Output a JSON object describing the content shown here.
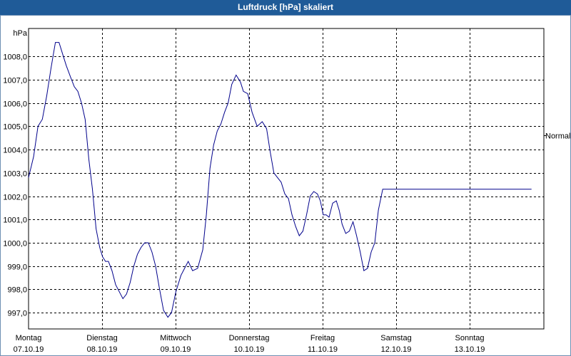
{
  "window": {
    "title": "Luftdruck [hPa] skaliert"
  },
  "chart_data": {
    "type": "line",
    "title": "Luftdruck [hPa] skaliert",
    "ylabel": "hPa",
    "ylim": [
      996.3,
      1009.2
    ],
    "yticks": [
      "997,0",
      "998,0",
      "999,0",
      "1000,0",
      "1001,0",
      "1002,0",
      "1003,0",
      "1004,0",
      "1005,0",
      "1006,0",
      "1007,0",
      "1008,0"
    ],
    "ytick_values": [
      997,
      998,
      999,
      1000,
      1001,
      1002,
      1003,
      1004,
      1005,
      1006,
      1007,
      1008
    ],
    "xlim": [
      0,
      7.1
    ],
    "days": [
      {
        "weekday": "Montag",
        "date": "07.10.19"
      },
      {
        "weekday": "Dienstag",
        "date": "08.10.19"
      },
      {
        "weekday": "Mittwoch",
        "date": "09.10.19"
      },
      {
        "weekday": "Donnerstag",
        "date": "10.10.19"
      },
      {
        "weekday": "Freitag",
        "date": "11.10.19"
      },
      {
        "weekday": "Samstag",
        "date": "12.10.19"
      },
      {
        "weekday": "Sonntag",
        "date": "13.10.19"
      }
    ],
    "reference": {
      "label": "Normal",
      "value": 1004.6
    },
    "grid": true,
    "series": [
      {
        "color": "#00008b",
        "x": [
          0,
          0.07,
          0.13,
          0.19,
          0.25,
          0.31,
          0.37,
          0.42,
          0.48,
          0.52,
          0.58,
          0.63,
          0.68,
          0.73,
          0.78,
          0.83,
          0.88,
          0.93,
          0.98,
          1.02,
          1.06,
          1.1,
          1.15,
          1.2,
          1.25,
          1.3,
          1.35,
          1.4,
          1.45,
          1.5,
          1.55,
          1.6,
          1.65,
          1.7,
          1.75,
          1.8,
          1.86,
          1.92,
          1.97,
          2.03,
          2.1,
          2.15,
          2.2,
          2.26,
          2.33,
          2.4,
          2.45,
          2.5,
          2.55,
          2.6,
          2.65,
          2.7,
          2.75,
          2.8,
          2.86,
          2.92,
          2.96,
          3.02,
          3.08,
          3.15,
          3.22,
          3.28,
          3.33,
          3.38,
          3.43,
          3.48,
          3.53,
          3.58,
          3.63,
          3.68,
          3.73,
          3.78,
          3.83,
          3.88,
          3.93,
          3.98,
          4.02,
          4.06,
          4.1,
          4.14,
          4.19,
          4.24,
          4.28,
          4.32,
          4.37,
          4.42,
          4.47,
          4.52,
          4.57,
          4.62,
          4.67,
          4.72,
          4.77,
          4.82,
          4.88,
          4.93,
          4.98,
          5.03,
          5.08,
          5.13,
          5.18,
          5.23,
          5.28,
          5.33,
          5.38,
          5.43,
          5.48,
          5.53,
          5.58,
          5.63,
          5.68,
          5.73,
          5.78,
          5.83,
          5.88,
          5.93,
          5.98,
          6.03,
          6.08,
          6.13,
          6.18,
          6.23,
          6.28,
          6.33,
          6.38,
          6.43,
          6.48,
          6.53,
          6.58,
          6.63,
          6.68,
          6.73,
          6.78,
          6.83,
          6.88,
          6.93,
          6.98
        ],
        "values": [
          1002.8,
          1003.7,
          1005.0,
          1005.3,
          1006.3,
          1007.5,
          1008.6,
          1008.6,
          1008.0,
          1007.6,
          1007.1,
          1006.7,
          1006.5,
          1006.0,
          1005.3,
          1003.6,
          1002.3,
          1000.6,
          999.8,
          999.4,
          999.2,
          999.2,
          998.8,
          998.2,
          997.9,
          997.6,
          997.8,
          998.3,
          999.0,
          999.5,
          999.8,
          1000.0,
          1000.0,
          999.6,
          999.0,
          998.1,
          997.1,
          996.8,
          997.0,
          997.9,
          998.6,
          998.9,
          999.2,
          998.8,
          998.9,
          999.7,
          1001.2,
          1003.2,
          1004.2,
          1004.8,
          1005.1,
          1005.6,
          1006.0,
          1006.8,
          1007.2,
          1006.9,
          1006.5,
          1006.4,
          1005.6,
          1005.0,
          1005.2,
          1004.9,
          1003.9,
          1003.0,
          1002.8,
          1002.6,
          1002.1,
          1001.9,
          1001.2,
          1000.7,
          1000.3,
          1000.5,
          1001.2,
          1002.0,
          1002.2,
          1002.1,
          1001.8,
          1001.2,
          1001.2,
          1001.1,
          1001.7,
          1001.8,
          1001.4,
          1000.8,
          1000.4,
          1000.5,
          1000.9,
          1000.3,
          999.6,
          998.8,
          998.9,
          999.6,
          1000.0,
          1001.4,
          1002.3,
          1002.3,
          1002.3,
          1002.3,
          1002.3,
          1002.3,
          1002.3,
          1002.3,
          1002.3,
          1002.3,
          1002.3,
          1002.3,
          1002.3,
          1002.3,
          1002.3,
          1002.3,
          1002.3,
          1002.3,
          1002.3,
          1002.3,
          1002.3,
          1002.3,
          1002.3,
          1002.3,
          1002.3,
          1002.3,
          1002.3,
          1002.3,
          1002.3,
          1002.3,
          1002.3,
          1002.3,
          1002.3,
          1002.3,
          1002.3,
          1002.3,
          1002.3,
          1002.3,
          1002.3,
          1002.3,
          1002.3,
          1002.3,
          1002.3
        ]
      }
    ]
  }
}
